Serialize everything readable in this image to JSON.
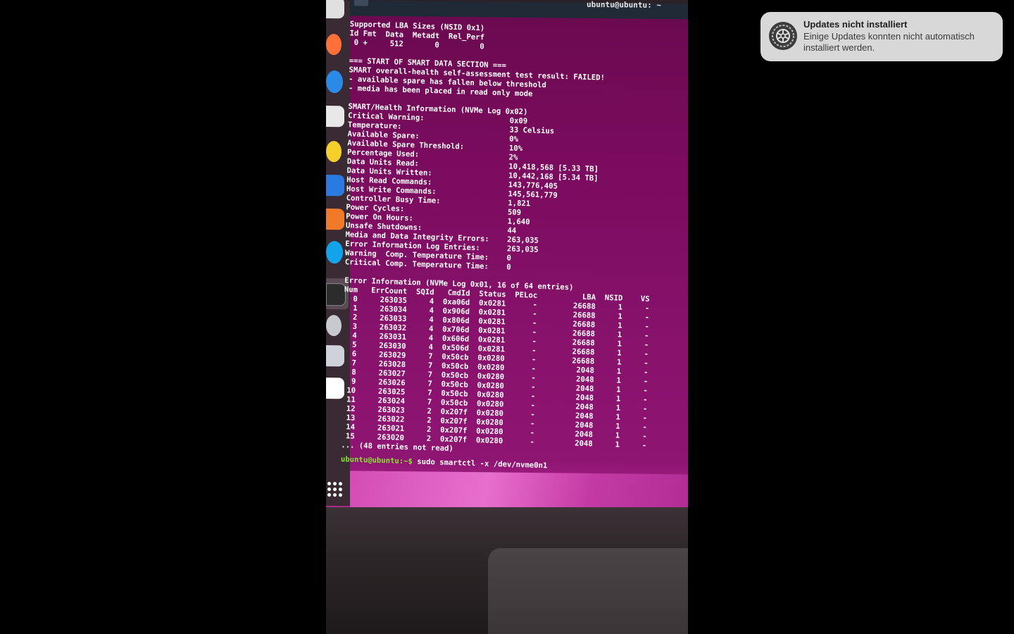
{
  "window": {
    "title": "ubuntu@ubuntu: ~"
  },
  "terminal": {
    "lines": [
      "Supported LBA Sizes (NSID 0x1)",
      "Id Fmt  Data  Metadt  Rel_Perf",
      " 0 +     512       0         0",
      "",
      "=== START OF SMART DATA SECTION ===",
      "SMART overall-health self-assessment test result: FAILED!",
      "- available spare has fallen below threshold",
      "- media has been placed in read only mode",
      "",
      "SMART/Health Information (NVMe Log 0x02)",
      "Critical Warning:                   0x09",
      "Temperature:                        33 Celsius",
      "Available Spare:                    0%",
      "Available Spare Threshold:          10%",
      "Percentage Used:                    2%",
      "Data Units Read:                    10,418,568 [5.33 TB]",
      "Data Units Written:                 10,442,168 [5.34 TB]",
      "Host Read Commands:                 143,776,405",
      "Host Write Commands:                145,561,779",
      "Controller Busy Time:               1,821",
      "Power Cycles:                       509",
      "Power On Hours:                     1,640",
      "Unsafe Shutdowns:                   44",
      "Media and Data Integrity Errors:    263,035",
      "Error Information Log Entries:      263,035",
      "Warning  Comp. Temperature Time:    0",
      "Critical Comp. Temperature Time:    0",
      "",
      "Error Information (NVMe Log 0x01, 16 of 64 entries)",
      "Num   ErrCount  SQId   CmdId  Status  PELoc          LBA  NSID    VS",
      "  0     263035     4  0xa06d  0x0281      -        26688     1     -",
      "  1     263034     4  0x906d  0x0281      -        26688     1     -",
      "  2     263033     4  0x806d  0x0281      -        26688     1     -",
      "  3     263032     4  0x706d  0x0281      -        26688     1     -",
      "  4     263031     4  0x606d  0x0281      -        26688     1     -",
      "  5     263030     4  0x506d  0x0281      -        26688     1     -",
      "  6     263029     7  0x50cb  0x0280      -        26688     1     -",
      "  7     263028     7  0x50cb  0x0280      -         2048     1     -",
      "  8     263027     7  0x50cb  0x0280      -         2048     1     -",
      "  9     263026     7  0x50cb  0x0280      -         2048     1     -",
      " 10     263025     7  0x50cb  0x0280      -         2048     1     -",
      " 11     263024     7  0x50cb  0x0280      -         2048     1     -",
      " 12     263023     2  0x207f  0x0280      -         2048     1     -",
      " 13     263022     2  0x207f  0x0280      -         2048     1     -",
      " 14     263021     2  0x207f  0x0280      -         2048     1     -",
      " 15     263020     2  0x207f  0x0280      -         2048     1     -",
      "... (48 entries not read)"
    ],
    "prompt": "ubuntu@ubuntu:~$",
    "command": " sudo smartctl -x /dev/nvme0n1"
  },
  "dock": {
    "items": [
      {
        "icon": "help-icon",
        "color": "#e0e0e0"
      },
      {
        "icon": "firefox-icon",
        "color": "#ff7139"
      },
      {
        "icon": "thunderbird-icon",
        "color": "#2a8ae6"
      },
      {
        "icon": "files-icon",
        "color": "#e8e8e8"
      },
      {
        "icon": "rhythmbox-icon",
        "color": "#f5d02b"
      },
      {
        "icon": "writer-icon",
        "color": "#2a7ae2"
      },
      {
        "icon": "app-center-icon",
        "color": "#f07a2a"
      },
      {
        "icon": "help-icon",
        "color": "#12a4ea"
      },
      {
        "icon": "terminal-icon",
        "color": "#2c2c2c"
      },
      {
        "icon": "disc-icon",
        "color": "#c8c8d0"
      },
      {
        "icon": "drive-icon",
        "color": "#cfd2da"
      },
      {
        "icon": "trash-icon",
        "color": "#ffffff"
      }
    ]
  },
  "notification": {
    "title": "Updates nicht installiert",
    "body": "Einige Updates konnten nicht automatisch installiert werden."
  }
}
